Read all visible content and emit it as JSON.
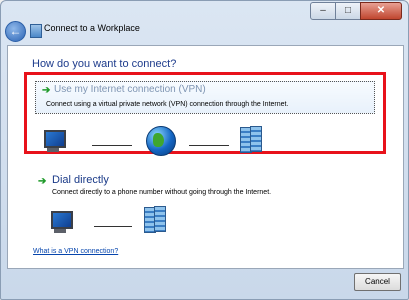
{
  "window": {
    "title": "Connect to a Workplace",
    "controls": {
      "minimize": "–",
      "maximize": "□",
      "close": "✕"
    },
    "back_glyph": "←"
  },
  "main": {
    "heading": "How do you want to connect?",
    "options": [
      {
        "title": "Use my Internet connection (VPN)",
        "description": "Connect using a virtual private network (VPN) connection through the Internet.",
        "icons": [
          "computer-icon",
          "internet-globe-icon",
          "workplace-network-icon"
        ]
      },
      {
        "title": "Dial directly",
        "description": "Connect directly to a phone number without going through the Internet.",
        "icons": [
          "computer-icon",
          "workplace-network-icon"
        ]
      }
    ],
    "help_link": "What is a VPN connection?"
  },
  "footer": {
    "cancel_label": "Cancel"
  },
  "colors": {
    "highlight_border": "#e8121b",
    "heading": "#1e3c8c",
    "arrow": "#1f9a2a",
    "link": "#0645ad"
  }
}
